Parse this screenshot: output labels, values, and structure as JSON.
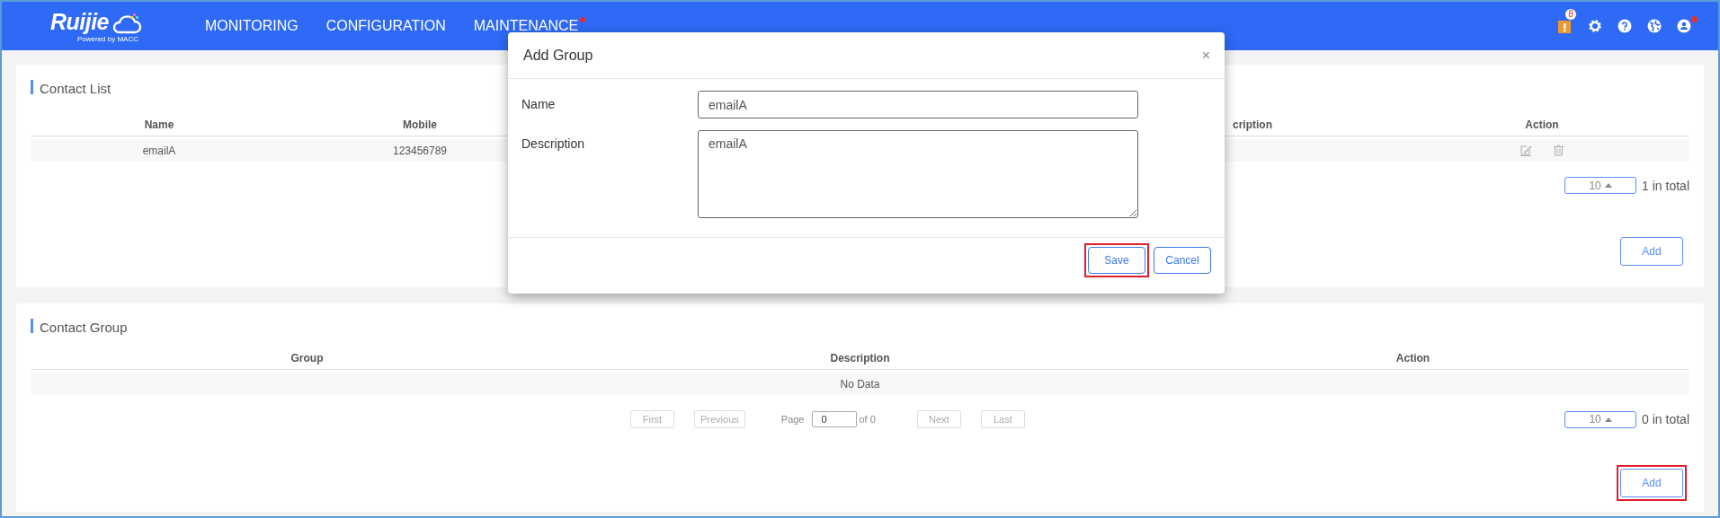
{
  "header": {
    "logo": "Ruijie",
    "logo_tagline": "Powered by MACC",
    "nav": [
      {
        "label": "MONITORING",
        "alert": false
      },
      {
        "label": "CONFIGURATION",
        "alert": false
      },
      {
        "label": "MAINTENANCE",
        "alert": true
      }
    ],
    "alerts_badge": "8",
    "user_alert": true
  },
  "contact_list": {
    "title": "Contact List",
    "columns": [
      "Name",
      "Mobile",
      "cription",
      "Action"
    ],
    "rows": [
      {
        "cells": [
          "emailA",
          "123456789"
        ]
      }
    ],
    "page_size": "10",
    "total": "1 in total",
    "add_button": {
      "label": "Add",
      "highlighted": false
    }
  },
  "contact_group": {
    "title": "Contact Group",
    "columns": [
      "Group",
      "Description",
      "Action"
    ],
    "empty": "No Data",
    "pager": {
      "buttons": [
        {
          "label": "First",
          "disabled": true
        },
        {
          "label": "Previous",
          "disabled": true
        }
      ],
      "page_label": "Page",
      "page": "0",
      "of": "of 0",
      "buttons_after": [
        {
          "label": "Next",
          "disabled": true
        },
        {
          "label": "Last",
          "disabled": true
        }
      ]
    },
    "page_size": "10",
    "total": "0 in total",
    "add_button": {
      "label": "Add",
      "highlighted": true
    }
  },
  "dialog": {
    "title": "Add Group",
    "close": "×",
    "fields": [
      {
        "label": "Name",
        "kind": "input",
        "value": "emailA"
      },
      {
        "label": "Description",
        "kind": "textarea",
        "value": "emailA"
      }
    ],
    "buttons": [
      {
        "label": "Save",
        "highlighted": true
      },
      {
        "label": "Cancel",
        "highlighted": false
      }
    ]
  }
}
